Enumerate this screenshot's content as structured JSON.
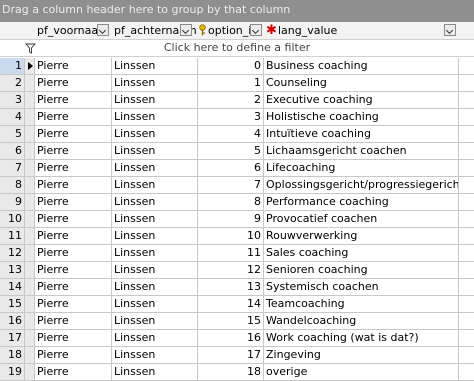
{
  "group_bar": {
    "text": "Drag a column header here to group by that column"
  },
  "headers": {
    "first_name": "pf_voornaam",
    "last_name": "pf_achternaam",
    "option_id": "option_id",
    "lang_value": "lang_value"
  },
  "filter": {
    "placeholder": "Click here to define a filter"
  },
  "rows": [
    {
      "num": "1",
      "first": "Pierre",
      "last": "Linssen",
      "option": "0",
      "value": "Business coaching"
    },
    {
      "num": "2",
      "first": "Pierre",
      "last": "Linssen",
      "option": "1",
      "value": "Counseling"
    },
    {
      "num": "3",
      "first": "Pierre",
      "last": "Linssen",
      "option": "2",
      "value": "Executive coaching"
    },
    {
      "num": "4",
      "first": "Pierre",
      "last": "Linssen",
      "option": "3",
      "value": "Holistische coaching"
    },
    {
      "num": "5",
      "first": "Pierre",
      "last": "Linssen",
      "option": "4",
      "value": "Intuïtieve coaching"
    },
    {
      "num": "6",
      "first": "Pierre",
      "last": "Linssen",
      "option": "5",
      "value": "Lichaamsgericht coachen"
    },
    {
      "num": "7",
      "first": "Pierre",
      "last": "Linssen",
      "option": "6",
      "value": "Lifecoaching"
    },
    {
      "num": "8",
      "first": "Pierre",
      "last": "Linssen",
      "option": "7",
      "value": "Oplossingsgericht/progressiegericht coachen"
    },
    {
      "num": "9",
      "first": "Pierre",
      "last": "Linssen",
      "option": "8",
      "value": "Performance coaching"
    },
    {
      "num": "10",
      "first": "Pierre",
      "last": "Linssen",
      "option": "9",
      "value": "Provocatief coachen"
    },
    {
      "num": "11",
      "first": "Pierre",
      "last": "Linssen",
      "option": "10",
      "value": "Rouwverwerking"
    },
    {
      "num": "12",
      "first": "Pierre",
      "last": "Linssen",
      "option": "11",
      "value": "Sales coaching"
    },
    {
      "num": "13",
      "first": "Pierre",
      "last": "Linssen",
      "option": "12",
      "value": "Senioren coaching"
    },
    {
      "num": "14",
      "first": "Pierre",
      "last": "Linssen",
      "option": "13",
      "value": "Systemisch coachen"
    },
    {
      "num": "15",
      "first": "Pierre",
      "last": "Linssen",
      "option": "14",
      "value": "Teamcoaching"
    },
    {
      "num": "16",
      "first": "Pierre",
      "last": "Linssen",
      "option": "15",
      "value": "Wandelcoaching"
    },
    {
      "num": "17",
      "first": "Pierre",
      "last": "Linssen",
      "option": "16",
      "value": "Work coaching (wat is dat?)"
    },
    {
      "num": "18",
      "first": "Pierre",
      "last": "Linssen",
      "option": "17",
      "value": "Zingeving"
    },
    {
      "num": "19",
      "first": "Pierre",
      "last": "Linssen",
      "option": "18",
      "value": "overige"
    }
  ],
  "selected_row": "1"
}
